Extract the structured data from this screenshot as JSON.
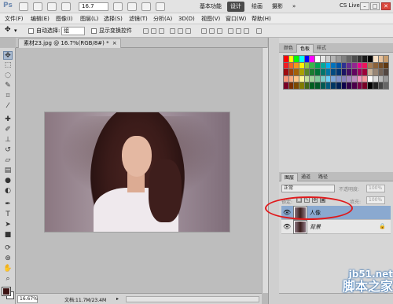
{
  "app": {
    "logo": "Ps",
    "zoom": "16.7",
    "workspaces": [
      "基本功能",
      "设计",
      "绘画",
      "摄影"
    ],
    "workspace_more": "»",
    "cs_live": "CS Live ▾"
  },
  "menu": [
    "文件(F)",
    "编辑(E)",
    "图像(I)",
    "图层(L)",
    "选择(S)",
    "滤镜(T)",
    "分析(A)",
    "3D(D)",
    "视图(V)",
    "窗口(W)",
    "帮助(H)"
  ],
  "options": {
    "auto_select_label": "自动选择:",
    "auto_select_value": "组",
    "show_transform_label": "显示变换控件"
  },
  "document": {
    "tab_title": "素材23.jpg @ 16.7%(RGB/8#) *",
    "zoom_status": "16.67%",
    "doc_info": "文档:11.7M/23.4M"
  },
  "panels": {
    "color_tabs": [
      "颜色",
      "色板",
      "样式"
    ],
    "layers_tabs": [
      "图层",
      "通道",
      "路径"
    ],
    "blend_mode": "正常",
    "opacity_label": "不透明度:",
    "opacity_value": "100%",
    "lock_label": "锁定:",
    "fill_label": "填充:",
    "fill_value": "100%",
    "layers": [
      {
        "name": "人像",
        "selected": true,
        "italic": false,
        "locked": false
      },
      {
        "name": "背景",
        "selected": false,
        "italic": true,
        "locked": true
      }
    ]
  },
  "watermark": {
    "url": "jb51.net",
    "text": "脚本之家"
  },
  "colors": {
    "accent_red": "#e0191b",
    "selected_layer": "#8aa9d0"
  }
}
